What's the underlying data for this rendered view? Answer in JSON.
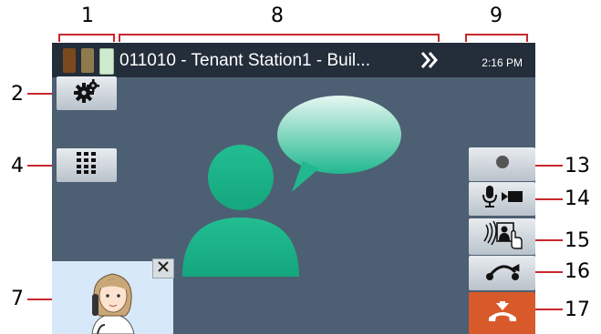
{
  "callouts": {
    "c1": "1",
    "c2": "2",
    "c4": "4",
    "c7": "7",
    "c8": "8",
    "c9": "9",
    "c13": "13",
    "c14": "14",
    "c15": "15",
    "c16": "16",
    "c17": "17"
  },
  "status_bar": {
    "station_label": "011010 - Tenant Station1 - Buil...",
    "time": "2:16 PM"
  },
  "signal_colors": [
    "#7a4a1e",
    "#8f7a4e",
    "#cfe9cf"
  ],
  "icons": {
    "settings": "gear-icon",
    "keypad": "keypad-icon",
    "record": "record-icon",
    "mic_video": "mic-video-icon",
    "door_monitor": "door-monitor-icon",
    "transfer": "transfer-icon",
    "end_call": "end-call-icon",
    "chevron": "double-chevron-icon",
    "close": "close-icon"
  },
  "colors": {
    "screen_bg": "#4d5f72",
    "avatar": "#1fb88f",
    "end_call": "#d85a2a",
    "callout_line": "#c8282d"
  }
}
